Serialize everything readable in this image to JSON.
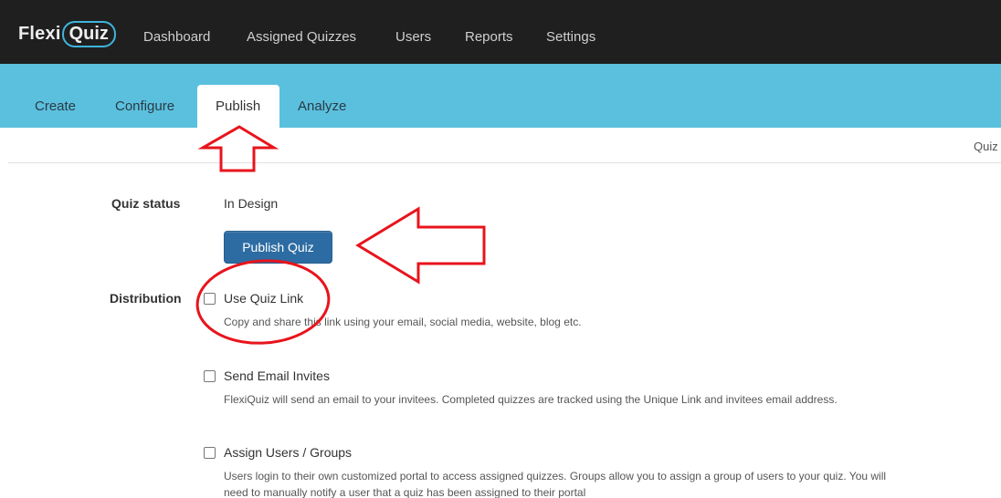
{
  "brand": {
    "name_part1": "Flexi",
    "name_part2": "Quiz"
  },
  "top_nav": {
    "items": [
      {
        "label": "Dashboard"
      },
      {
        "label": "Assigned Quizzes"
      },
      {
        "label": "Users"
      },
      {
        "label": "Reports"
      },
      {
        "label": "Settings"
      }
    ]
  },
  "sub_nav": {
    "tabs": [
      {
        "label": "Create"
      },
      {
        "label": "Configure"
      },
      {
        "label": "Publish",
        "active": true
      },
      {
        "label": "Analyze"
      }
    ]
  },
  "header_right": {
    "text": "Quiz"
  },
  "status": {
    "label": "Quiz status",
    "value": "In Design",
    "publish_button": "Publish Quiz"
  },
  "distribution": {
    "label": "Distribution",
    "options": [
      {
        "title": "Use Quiz Link",
        "description": "Copy and share this link using your email, social media, website, blog etc.",
        "checked": false
      },
      {
        "title": "Send Email Invites",
        "description": "FlexiQuiz will send an email to your invitees. Completed quizzes are tracked using the Unique Link and invitees email address.",
        "checked": false
      },
      {
        "title": "Assign Users / Groups",
        "description_line1": "Users login to their own customized portal to access assigned quizzes. Groups allow you to assign a group of users to your quiz. You will",
        "description_line2": "need to manually notify a user that a quiz has been assigned to their portal",
        "checked": false
      }
    ]
  },
  "colors": {
    "topbar": "#1f1f1f",
    "subbar": "#5bc0de",
    "button": "#2d6ca2",
    "annotation": "#e8141c"
  }
}
